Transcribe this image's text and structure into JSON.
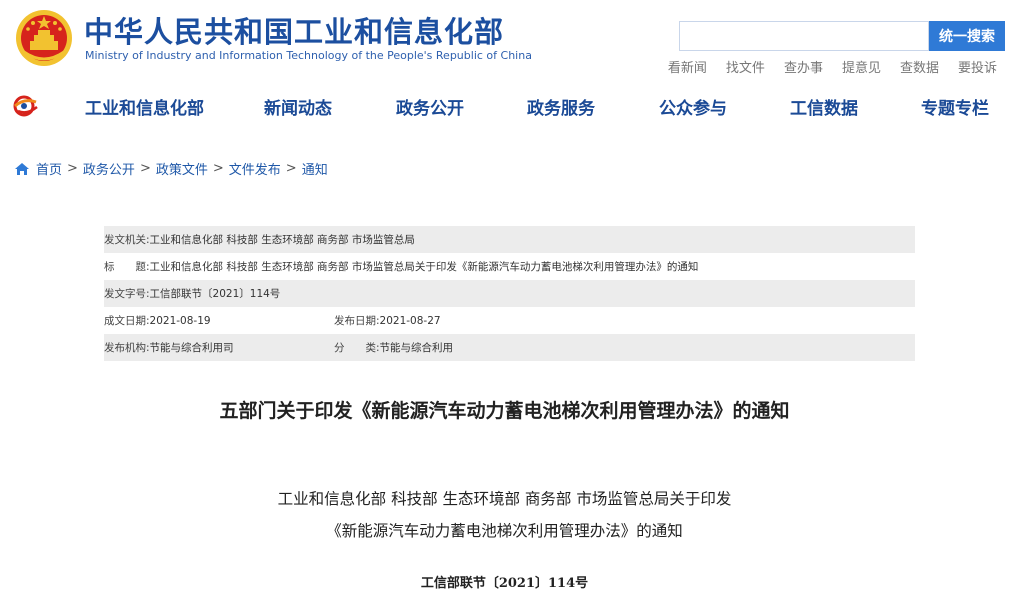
{
  "header": {
    "title_cn": "中华人民共和国工业和信息化部",
    "title_en": "Ministry of Industry and Information Technology of the People's Republic of China",
    "search": {
      "placeholder": "",
      "button_label": "统一搜索"
    },
    "quick_links": [
      "看新闻",
      "找文件",
      "查办事",
      "提意见",
      "查数据",
      "要投诉"
    ]
  },
  "nav": {
    "items": [
      "工业和信息化部",
      "新闻动态",
      "政务公开",
      "政务服务",
      "公众参与",
      "工信数据",
      "专题专栏"
    ]
  },
  "breadcrumb": [
    "首页",
    "政务公开",
    "政策文件",
    "文件发布",
    "通知"
  ],
  "info": {
    "issuer_label": "发文机关:",
    "issuer_value": "工业和信息化部 科技部 生态环境部 商务部 市场监管总局",
    "title_label": "标　　题:",
    "title_value": "工业和信息化部 科技部 生态环境部 商务部 市场监管总局关于印发《新能源汽车动力蓄电池梯次利用管理办法》的通知",
    "docno_label": "发文字号:",
    "docno_value": "工信部联节〔2021〕114号",
    "written_label": "成文日期:",
    "written_value": "2021-08-19",
    "published_label": "发布日期:",
    "published_value": "2021-08-27",
    "org_label": "发布机构:",
    "org_value": "节能与综合利用司",
    "category_label": "分　　类:",
    "category_value": "节能与综合利用"
  },
  "article": {
    "heading": "五部门关于印发《新能源汽车动力蓄电池梯次利用管理办法》的通知",
    "body_title_line1": "工业和信息化部 科技部 生态环境部 商务部 市场监管总局关于印发",
    "body_title_line2": "《新能源汽车动力蓄电池梯次利用管理办法》的通知",
    "doc_number": "工信部联节〔2021〕114号"
  },
  "colors": {
    "brand_blue": "#1c4fa0",
    "search_button": "#2f7ad6",
    "emblem_red": "#d6231c",
    "emblem_gold": "#f2c230"
  }
}
